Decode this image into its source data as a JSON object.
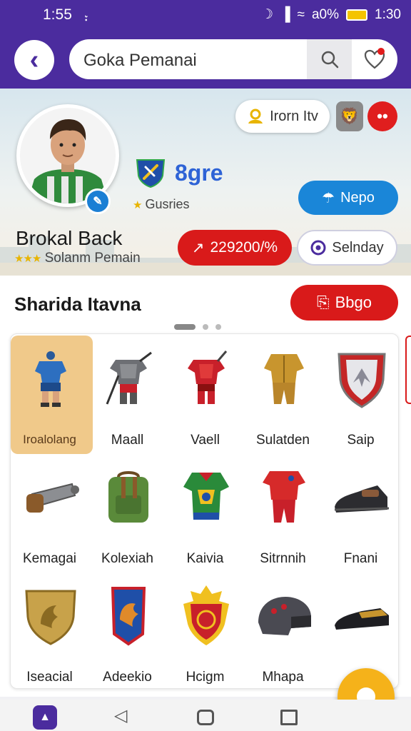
{
  "status_bar": {
    "time_left": "1:55",
    "time_right": "1:30",
    "battery": "а0%"
  },
  "search": {
    "value": "Goka Pemanai"
  },
  "profile": {
    "name": "Brokal Back",
    "subtitle": "Solanm Pemain",
    "club_name": "8gre",
    "club_subtitle": "Gusries",
    "iron_label": "Irorn Itv",
    "nepo_label": "Nepo",
    "score_label": "229200/",
    "score_suffix": "%",
    "selnday_label": "Selnday"
  },
  "section": {
    "title": "Sharida Itavna",
    "button_label": "Bbgo"
  },
  "items": [
    {
      "label": "Iroalolang",
      "icon": "blue-kit-icon"
    },
    {
      "label": "Maall",
      "icon": "gray-armor-icon"
    },
    {
      "label": "Vaell",
      "icon": "red-armor-icon"
    },
    {
      "label": "Sulatden",
      "icon": "gold-suit-icon"
    },
    {
      "label": "Saip",
      "icon": "crest-shield-icon"
    },
    {
      "label": "Kemagai",
      "icon": "cannon-icon"
    },
    {
      "label": "Kolexiah",
      "icon": "backpack-icon"
    },
    {
      "label": "Kaivia",
      "icon": "green-shirt-icon"
    },
    {
      "label": "Sitrnnih",
      "icon": "red-kit-icon"
    },
    {
      "label": "Fnani",
      "icon": "black-shoe-icon"
    },
    {
      "label": "Iseacial",
      "icon": "gold-shield-icon"
    },
    {
      "label": "Adeekio",
      "icon": "banner-shield-icon"
    },
    {
      "label": "Hcigm",
      "icon": "red-badge-icon"
    },
    {
      "label": "Mhapa",
      "icon": "helmet-icon"
    },
    {
      "label": "",
      "icon": "loafer-icon"
    }
  ],
  "colors": {
    "brand_purple": "#4b2c9e",
    "accent_red": "#d91a1a",
    "accent_blue": "#1a86d8",
    "fab_yellow": "#f5b21a"
  }
}
